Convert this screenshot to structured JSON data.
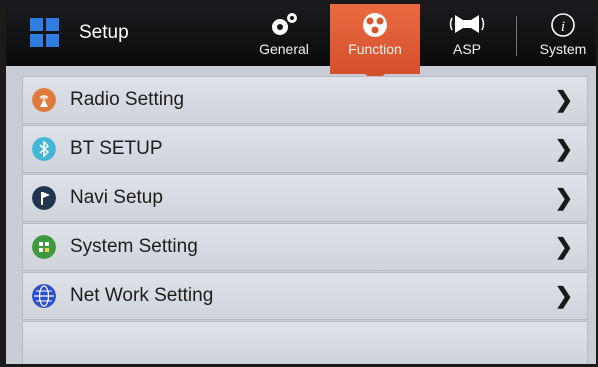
{
  "header": {
    "title": "Setup",
    "tabs": [
      {
        "label": "General",
        "icon": "gears-icon"
      },
      {
        "label": "Function",
        "icon": "function-icon",
        "active": true
      },
      {
        "label": "ASP",
        "icon": "speaker-icon"
      },
      {
        "label": "System",
        "icon": "info-icon"
      }
    ]
  },
  "menu": {
    "items": [
      {
        "label": "Radio Setting",
        "icon": "radio-icon",
        "color": "#e07a3c"
      },
      {
        "label": "BT SETUP",
        "icon": "bluetooth-icon",
        "color": "#43b6d6"
      },
      {
        "label": "Navi Setup",
        "icon": "navigation-icon",
        "color": "#1f3550"
      },
      {
        "label": "System Setting",
        "icon": "system-icon",
        "color": "#3f9a3f"
      },
      {
        "label": "Net Work Setting",
        "icon": "globe-icon",
        "color": "#2a4fc9"
      }
    ],
    "chevron": "❯"
  },
  "colors": {
    "accent": "#d9572f",
    "topbar": "#111114",
    "background": "#c9ccd4"
  }
}
